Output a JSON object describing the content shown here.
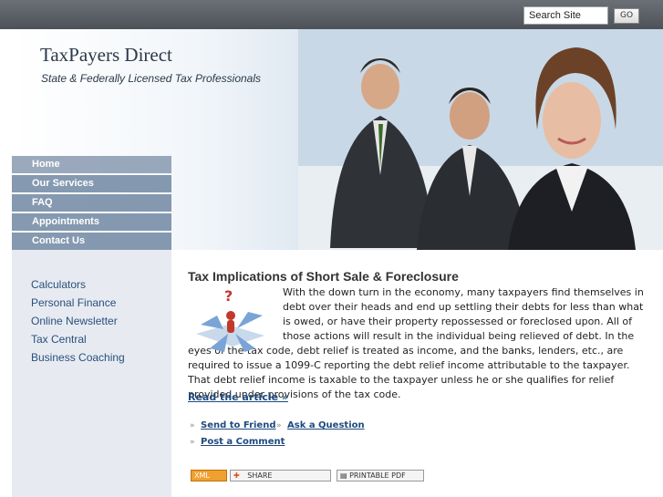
{
  "search": {
    "placeholder": "Search Site",
    "value": "Search Site",
    "go_label": "GO"
  },
  "header": {
    "title": "TaxPayers Direct",
    "tagline": "State & Federally Licensed Tax Professionals"
  },
  "nav": [
    "Home",
    "Our Services",
    "FAQ",
    "Appointments",
    "Contact Us"
  ],
  "sidebar": [
    "Calculators",
    "Personal Finance",
    "Online Newsletter",
    "Tax Central",
    "Business Coaching"
  ],
  "article": {
    "title": "Tax Implications of Short Sale & Foreclosure",
    "body": "With the down turn in the economy, many taxpayers find themselves in debt over their heads and end up settling their debts for less than what is owed, or have their property repossessed or foreclosed upon.  All of those actions will result in the individual being relieved of debt.  In the eyes of the tax code, debt relief is treated as income, and the banks, lenders, etc., are required to issue a 1099-C reporting the debt relief income attributable to the taxpayer.  That debt relief income is taxable to the taxpayer unless he or she qualifies for relief provided under provisions of the tax code.",
    "read_more": "Read the article »",
    "actions": {
      "send": "Send to Friend",
      "ask": "Ask a Question",
      "comment": "Post a Comment"
    }
  },
  "badges": {
    "xml": "XML",
    "share": "SHARE",
    "printable": "PRINTABLE PDF"
  },
  "colors": {
    "nav_bg": "#7087a2",
    "link": "#1d4a7f",
    "sidebar_bg": "#e7ebf1"
  }
}
